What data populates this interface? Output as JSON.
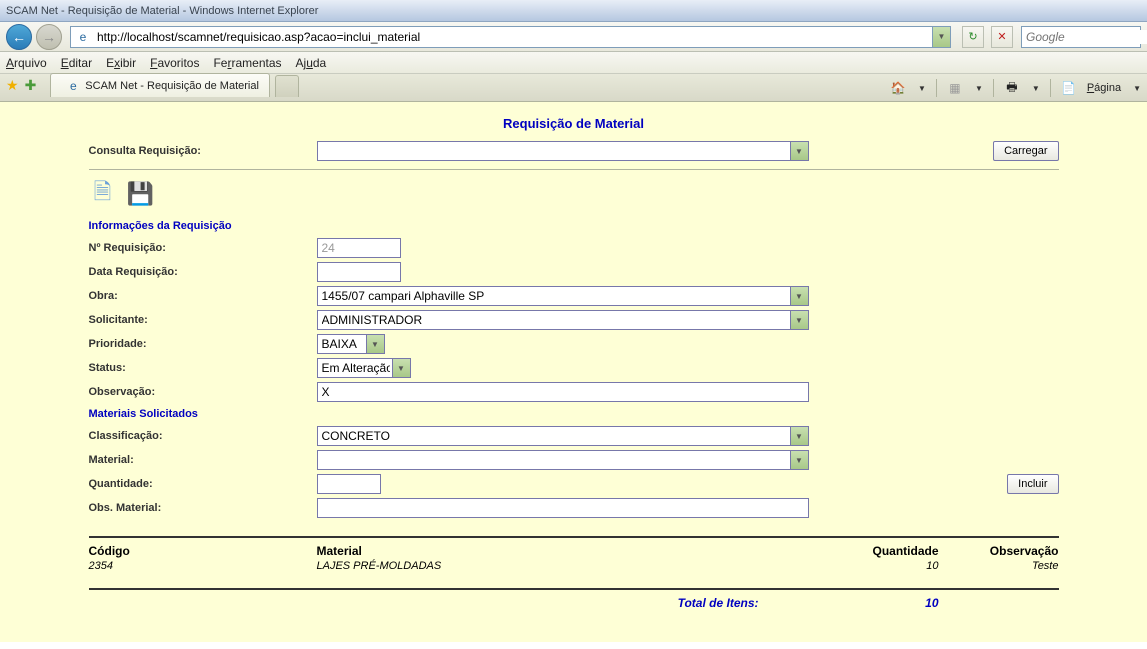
{
  "window_title": "SCAM Net - Requisição de Material - Windows Internet Explorer",
  "url": "http://localhost/scamnet/requisicao.asp?acao=inclui_material",
  "search_placeholder": "Google",
  "menu": {
    "arquivo": "Arquivo",
    "editar": "Editar",
    "exibir": "Exibir",
    "favoritos": "Favoritos",
    "ferramentas": "Ferramentas",
    "ajuda": "Ajuda"
  },
  "menu_underline": {
    "arquivo": "A",
    "editar": "E",
    "exibir": "x",
    "favoritos": "F",
    "ferramentas": "r",
    "ajuda": "u"
  },
  "tab_title": "SCAM Net - Requisição de Material",
  "toolbar_right": {
    "pagina": "Página"
  },
  "page": {
    "title": "Requisição de Material",
    "consulta_label": "Consulta Requisição:",
    "consulta_value": "",
    "carregar": "Carregar",
    "sec_info": "Informações da Requisição",
    "num_req_label": "Nº Requisição:",
    "num_req_value": "24",
    "data_req_label": "Data Requisição:",
    "data_req_value": "",
    "obra_label": "Obra:",
    "obra_value": "1455/07 campari Alphaville SP",
    "solicitante_label": "Solicitante:",
    "solicitante_value": "ADMINISTRADOR",
    "prioridade_label": "Prioridade:",
    "prioridade_value": "BAIXA",
    "status_label": "Status:",
    "status_value": "Em Alteração",
    "observacao_label": "Observação:",
    "observacao_value": "X",
    "sec_mat": "Materiais Solicitados",
    "class_label": "Classificação:",
    "class_value": "CONCRETO",
    "material_label": "Material:",
    "material_value": "",
    "qtd_label": "Quantidade:",
    "qtd_value": "",
    "incluir": "Incluir",
    "obsmat_label": "Obs. Material:",
    "obsmat_value": ""
  },
  "table": {
    "h_codigo": "Código",
    "h_material": "Material",
    "h_qtd": "Quantidade",
    "h_obs": "Observação",
    "r1_codigo": "2354",
    "r1_material": "LAJES PRÉ-MOLDADAS",
    "r1_qtd": "10",
    "r1_obs": "Teste",
    "total_label": "Total de Itens:",
    "total_value": "10"
  }
}
